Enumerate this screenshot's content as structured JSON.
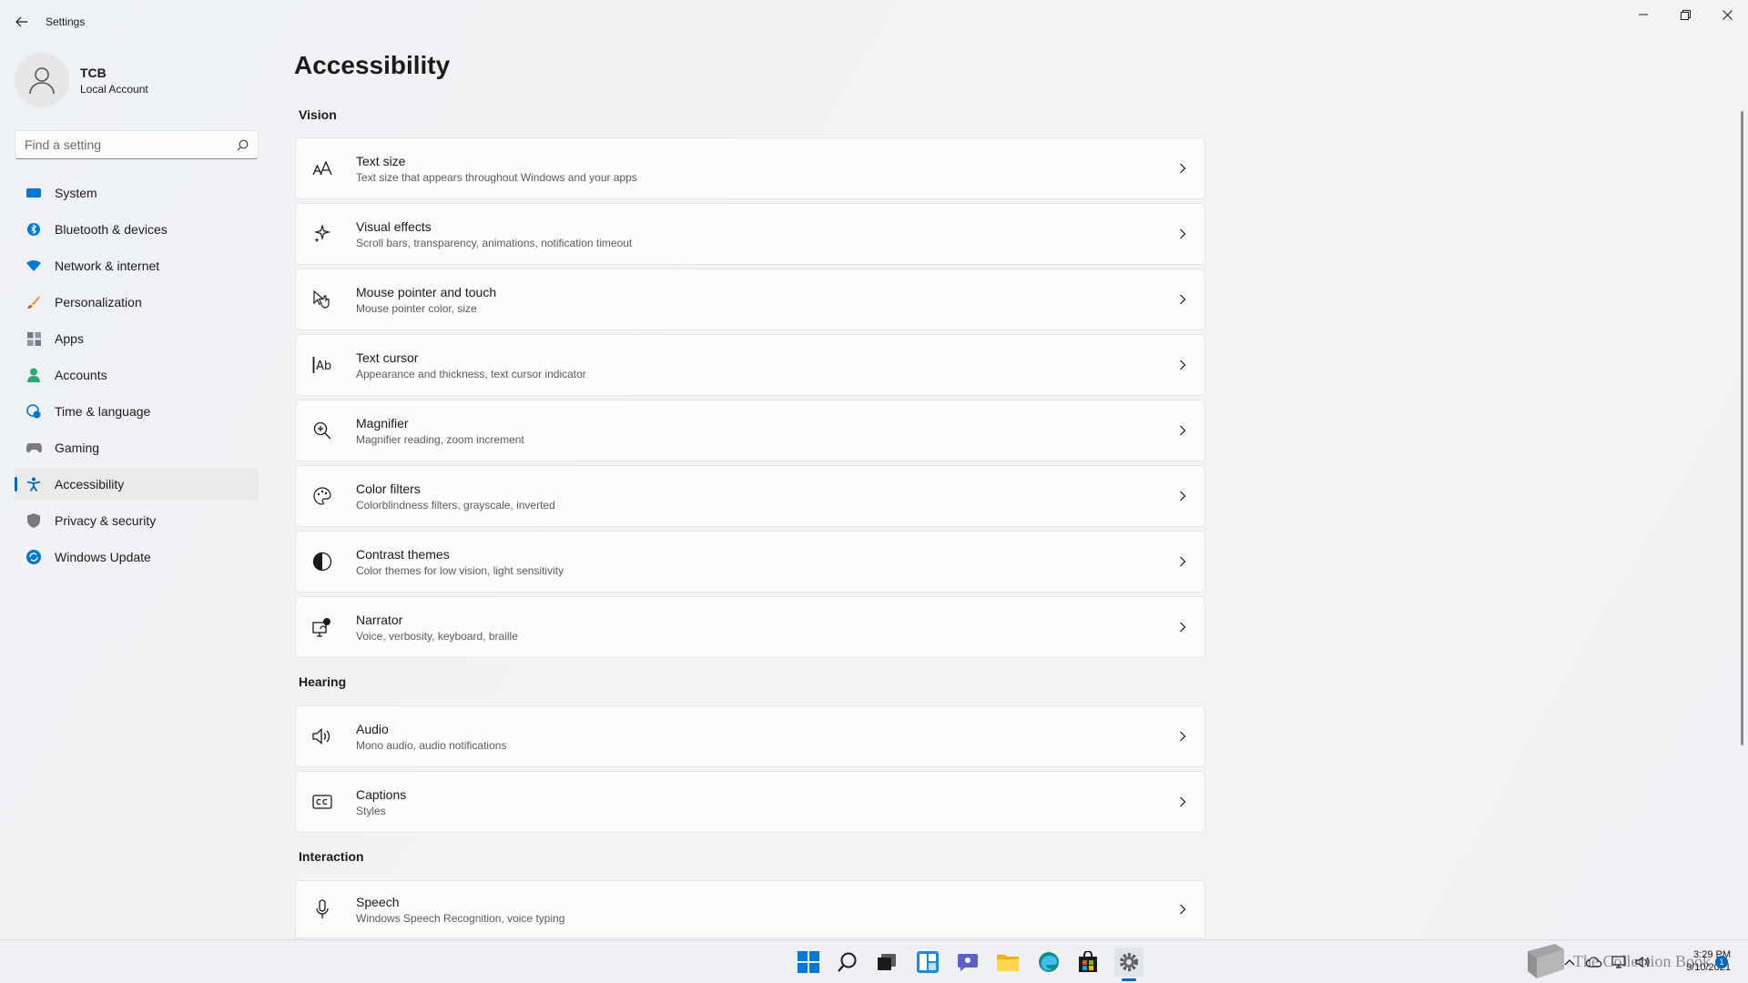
{
  "window": {
    "title": "Settings"
  },
  "profile": {
    "name": "TCB",
    "account_type": "Local Account"
  },
  "search": {
    "placeholder": "Find a setting"
  },
  "sidebar": {
    "items": [
      {
        "label": "System",
        "icon": "system-icon",
        "color": "#0078d4"
      },
      {
        "label": "Bluetooth & devices",
        "icon": "bluetooth-icon",
        "color": "#0078d4"
      },
      {
        "label": "Network & internet",
        "icon": "wifi-icon",
        "color": "#0078d4"
      },
      {
        "label": "Personalization",
        "icon": "brush-icon",
        "color": "#e8912d"
      },
      {
        "label": "Apps",
        "icon": "apps-icon",
        "color": "#6b7a8f"
      },
      {
        "label": "Accounts",
        "icon": "accounts-icon",
        "color": "#2aa876"
      },
      {
        "label": "Time & language",
        "icon": "globe-clock-icon",
        "color": "#0078d4"
      },
      {
        "label": "Gaming",
        "icon": "gamepad-icon",
        "color": "#7a7a7a"
      },
      {
        "label": "Accessibility",
        "icon": "accessibility-icon",
        "color": "#0067c0",
        "active": true
      },
      {
        "label": "Privacy & security",
        "icon": "shield-icon",
        "color": "#7a7a7a"
      },
      {
        "label": "Windows Update",
        "icon": "update-icon",
        "color": "#0078d4"
      }
    ]
  },
  "main": {
    "title": "Accessibility",
    "sections": [
      {
        "label": "Vision",
        "items": [
          {
            "title": "Text size",
            "desc": "Text size that appears throughout Windows and your apps",
            "icon": "text-size-icon"
          },
          {
            "title": "Visual effects",
            "desc": "Scroll bars, transparency, animations, notification timeout",
            "icon": "sparkle-icon"
          },
          {
            "title": "Mouse pointer and touch",
            "desc": "Mouse pointer color, size",
            "icon": "pointer-touch-icon"
          },
          {
            "title": "Text cursor",
            "desc": "Appearance and thickness, text cursor indicator",
            "icon": "text-cursor-icon"
          },
          {
            "title": "Magnifier",
            "desc": "Magnifier reading, zoom increment",
            "icon": "magnifier-icon"
          },
          {
            "title": "Color filters",
            "desc": "Colorblindness filters, grayscale, inverted",
            "icon": "palette-icon"
          },
          {
            "title": "Contrast themes",
            "desc": "Color themes for low vision, light sensitivity",
            "icon": "contrast-icon"
          },
          {
            "title": "Narrator",
            "desc": "Voice, verbosity, keyboard, braille",
            "icon": "narrator-icon"
          }
        ]
      },
      {
        "label": "Hearing",
        "items": [
          {
            "title": "Audio",
            "desc": "Mono audio, audio notifications",
            "icon": "speaker-icon"
          },
          {
            "title": "Captions",
            "desc": "Styles",
            "icon": "captions-icon"
          }
        ]
      },
      {
        "label": "Interaction",
        "items": [
          {
            "title": "Speech",
            "desc": "Windows Speech Recognition, voice typing",
            "icon": "microphone-icon"
          }
        ]
      }
    ]
  },
  "taskbar": {
    "apps": [
      "start-icon",
      "search-icon",
      "task-view-icon",
      "widgets-icon",
      "chat-icon",
      "file-explorer-icon",
      "edge-icon",
      "store-icon",
      "settings-icon"
    ],
    "clock_time": "3:29 PM",
    "clock_date": "9/10/2021",
    "notification_count": "1",
    "watermark": "The Collection Book"
  }
}
